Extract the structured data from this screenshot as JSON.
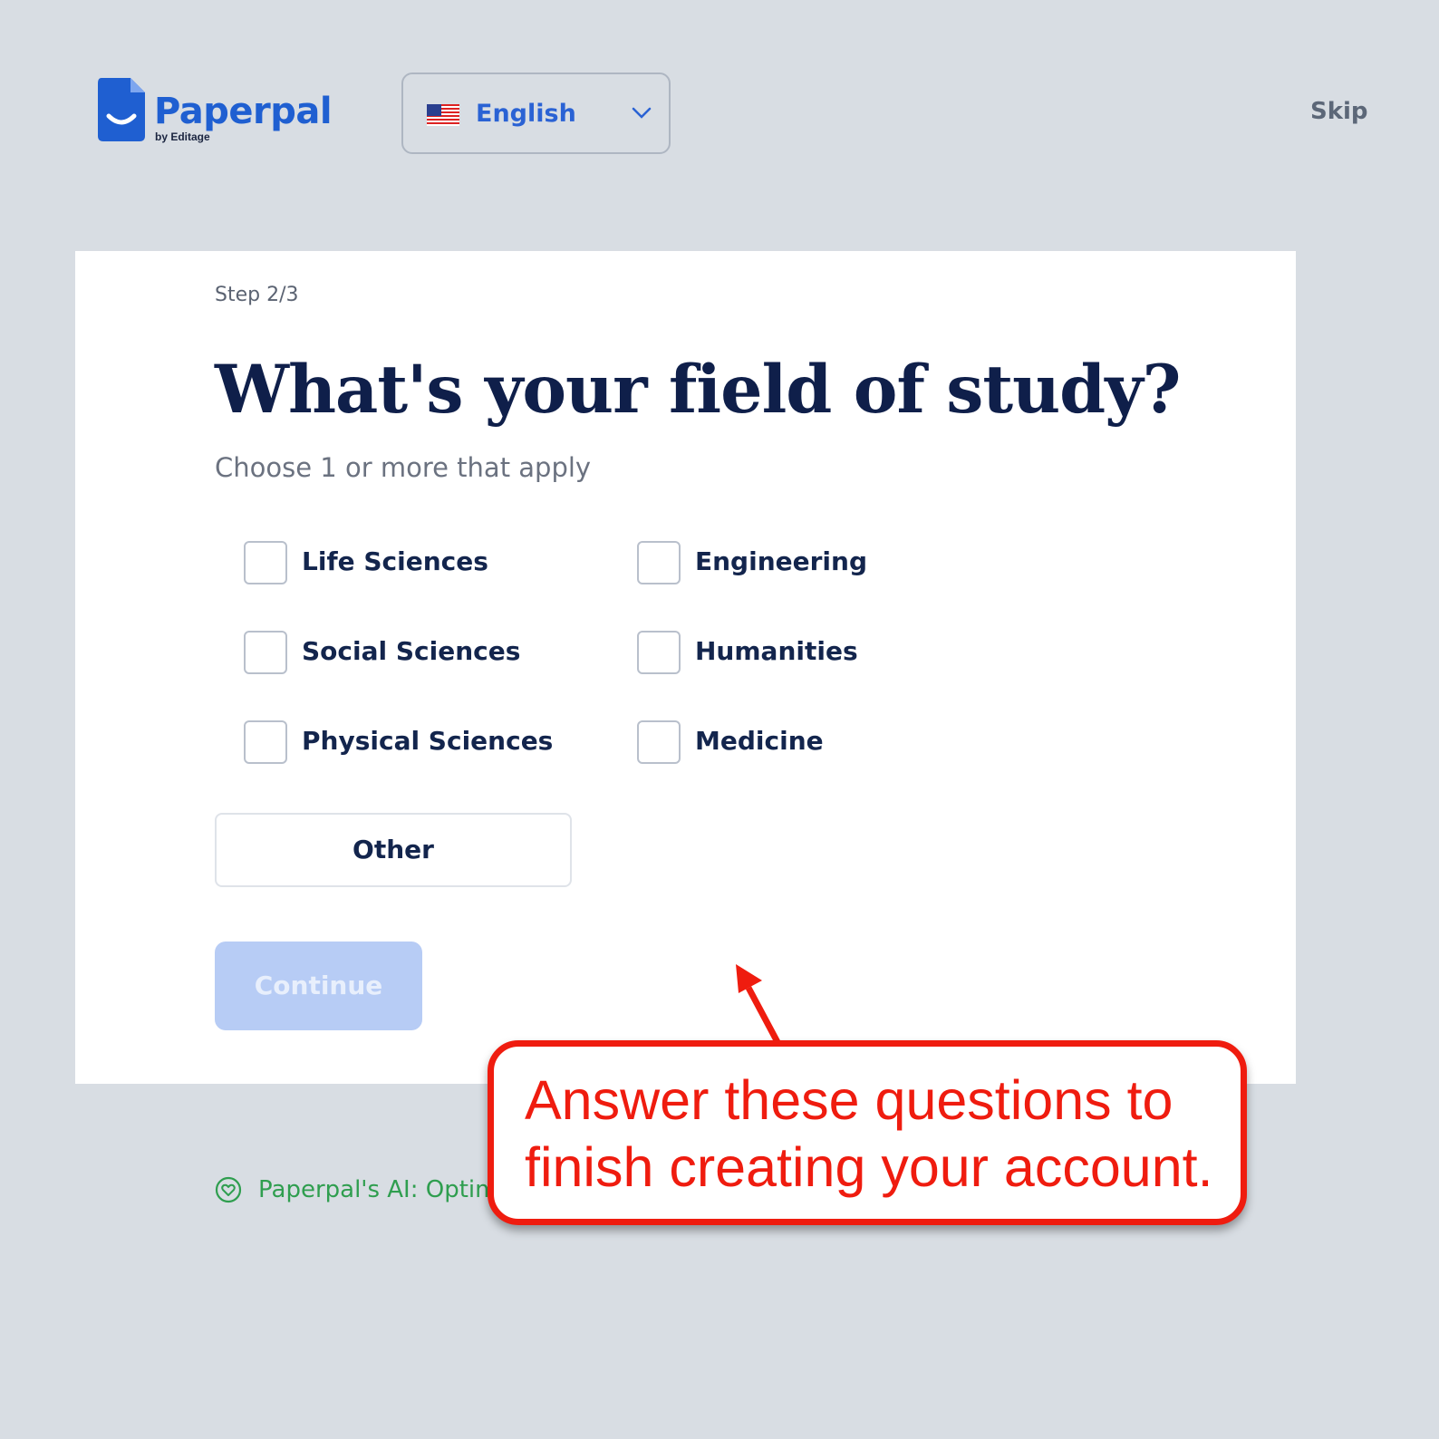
{
  "header": {
    "logo_text": "Paperpal",
    "logo_sub": "by Editage",
    "language": {
      "selected": "English",
      "flag_icon": "us-flag-icon"
    },
    "skip_label": "Skip"
  },
  "form": {
    "step": "Step 2/3",
    "title": "What's your field of study?",
    "subtitle": "Choose 1 or more that apply",
    "options": [
      {
        "label": "Life Sciences",
        "checked": false
      },
      {
        "label": "Engineering",
        "checked": false
      },
      {
        "label": "Social Sciences",
        "checked": false
      },
      {
        "label": "Humanities",
        "checked": false
      },
      {
        "label": "Physical Sciences",
        "checked": false
      },
      {
        "label": "Medicine",
        "checked": false
      }
    ],
    "other_label": "Other",
    "continue_label": "Continue"
  },
  "footer": {
    "text": "Paperpal's AI: Optim"
  },
  "callout": {
    "line1": "Answer these questions to",
    "line2": "finish creating your account."
  },
  "colors": {
    "brand": "#1f5fd1",
    "title": "#0f1f4a",
    "callout": "#ef1c0f",
    "footer_green": "#2f9e4f",
    "continue_disabled": "#b7ccf5"
  }
}
